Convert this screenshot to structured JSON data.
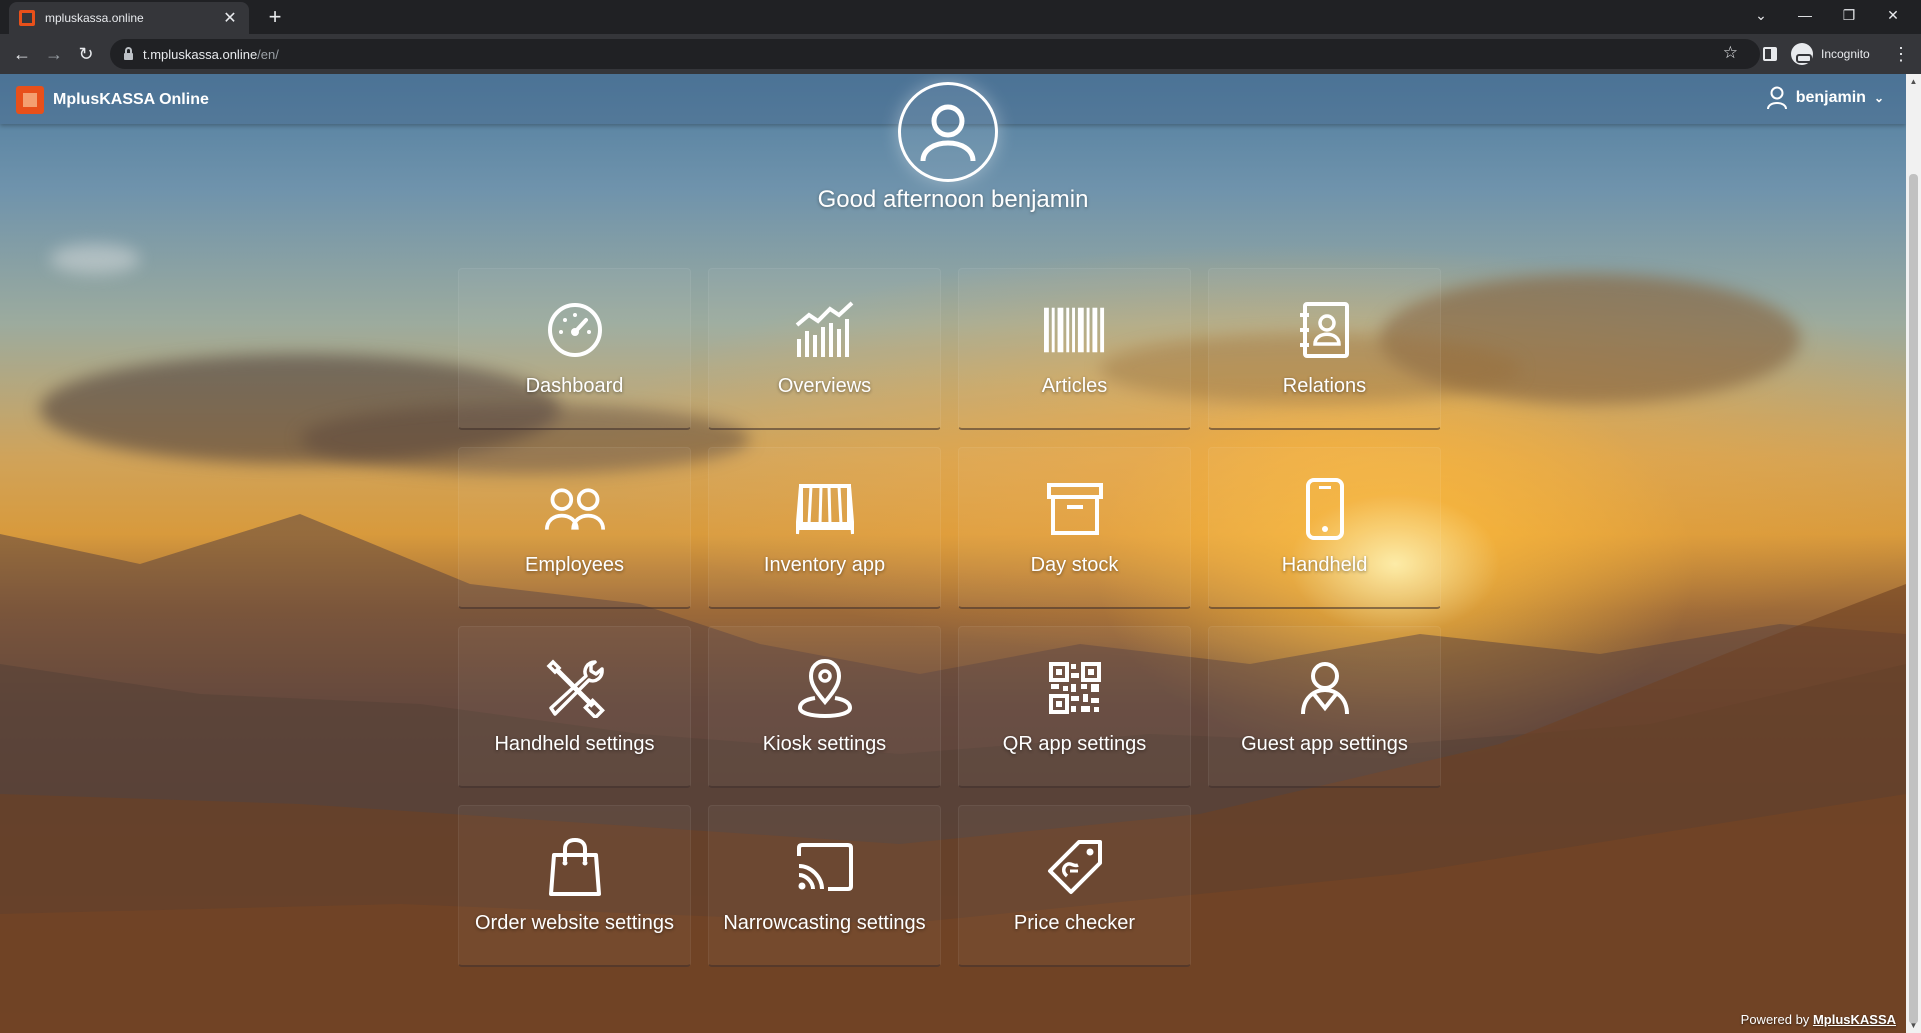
{
  "browser": {
    "tab_title": "mpluskassa.online",
    "tab_close": "✕",
    "new_tab": "+",
    "url_host": "t.mpluskassa.online",
    "url_path": "/en/",
    "incognito_label": "Incognito"
  },
  "header": {
    "brand": "MplusKASSA Online",
    "username": "benjamin"
  },
  "greeting": "Good afternoon benjamin",
  "tiles": [
    {
      "label": "Dashboard",
      "icon": "dashboard-gauge-icon"
    },
    {
      "label": "Overviews",
      "icon": "bar-chart-icon"
    },
    {
      "label": "Articles",
      "icon": "barcode-icon"
    },
    {
      "label": "Relations",
      "icon": "contacts-book-icon"
    },
    {
      "label": "Employees",
      "icon": "users-icon"
    },
    {
      "label": "Inventory app",
      "icon": "shelf-icon"
    },
    {
      "label": "Day stock",
      "icon": "archive-box-icon"
    },
    {
      "label": "Handheld",
      "icon": "mobile-phone-icon"
    },
    {
      "label": "Handheld settings",
      "icon": "tools-icon"
    },
    {
      "label": "Kiosk settings",
      "icon": "map-pin-icon"
    },
    {
      "label": "QR app settings",
      "icon": "qr-code-icon"
    },
    {
      "label": "Guest app settings",
      "icon": "guest-user-icon"
    },
    {
      "label": "Order website settings",
      "icon": "shopping-bag-icon"
    },
    {
      "label": "Narrowcasting settings",
      "icon": "cast-icon"
    },
    {
      "label": "Price checker",
      "icon": "price-tag-icon"
    }
  ],
  "footer": {
    "powered_prefix": "Powered by",
    "powered_link": "MplusKASSA"
  }
}
